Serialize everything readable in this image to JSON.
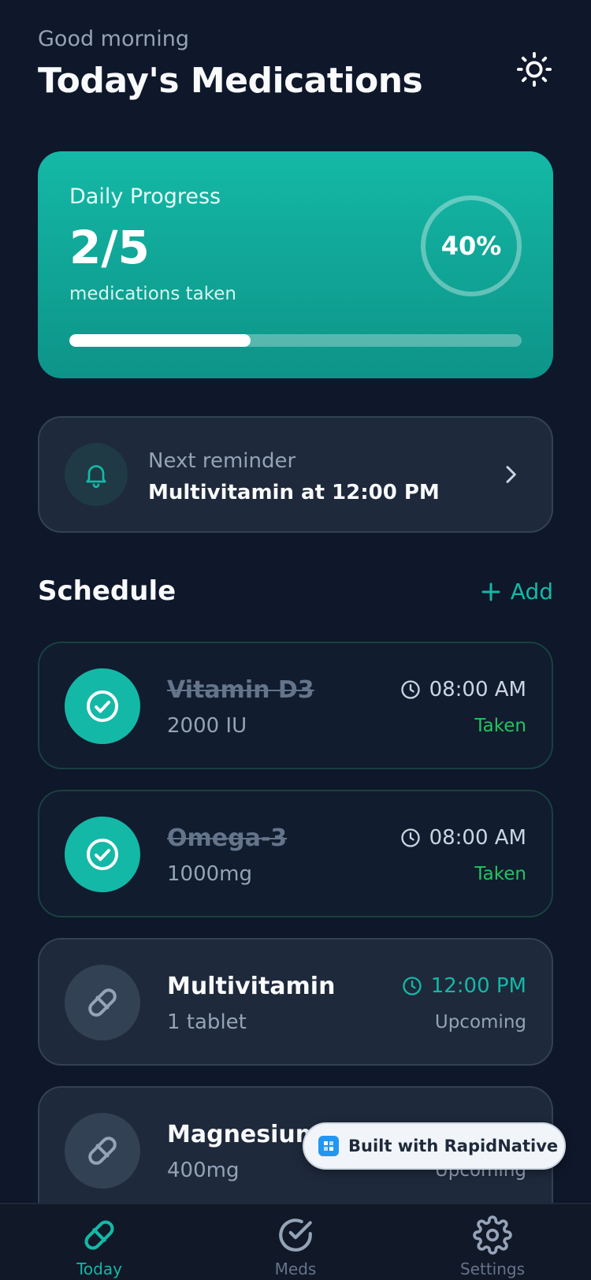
{
  "header": {
    "greeting": "Good morning",
    "title": "Today's Medications"
  },
  "progress": {
    "label": "Daily Progress",
    "count": "2/5",
    "subtitle": "medications taken",
    "percent_label": "40%",
    "fraction": 0.4
  },
  "reminder": {
    "label": "Next reminder",
    "text": "Multivitamin at 12:00 PM"
  },
  "schedule": {
    "title": "Schedule",
    "add_label": "Add",
    "items": [
      {
        "name": "Vitamin D3",
        "dose": "2000 IU",
        "time": "08:00 AM",
        "status": "Taken"
      },
      {
        "name": "Omega-3",
        "dose": "1000mg",
        "time": "08:00 AM",
        "status": "Taken"
      },
      {
        "name": "Multivitamin",
        "dose": "1 tablet",
        "time": "12:00 PM",
        "status": "Upcoming"
      },
      {
        "name": "Magnesium",
        "dose": "400mg",
        "time": "",
        "status": "Upcoming"
      }
    ]
  },
  "badge": {
    "text": "Built with RapidNative"
  },
  "tabs": [
    {
      "label": "Today",
      "icon": "pill-icon",
      "active": true
    },
    {
      "label": "Meds",
      "icon": "check-circle-icon",
      "active": false
    },
    {
      "label": "Settings",
      "icon": "gear-icon",
      "active": false
    }
  ],
  "colors": {
    "accent": "#14b8a6",
    "background": "#0f172a",
    "card": "#1e293b",
    "taken": "#22c55e"
  }
}
